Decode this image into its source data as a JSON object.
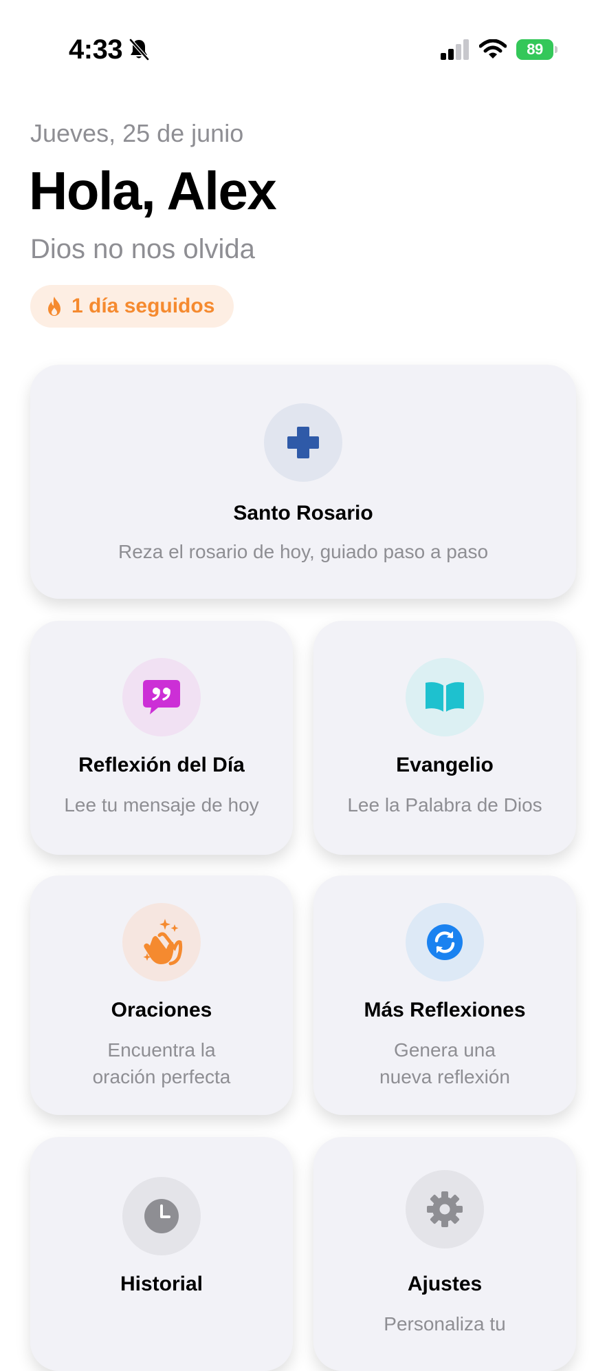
{
  "status_bar": {
    "time": "4:33",
    "battery": "89"
  },
  "header": {
    "date": "Jueves, 25 de junio",
    "greeting": "Hola, Alex",
    "subtitle": "Dios no nos olvida",
    "streak": "1 día seguidos"
  },
  "cards": {
    "rosario": {
      "title": "Santo Rosario",
      "desc": "Reza el rosario de hoy, guiado paso a paso",
      "icon": "plus-icon",
      "icon_color": "#2f5aa8",
      "bg_color": "#e1e5ef"
    },
    "reflexion": {
      "title": "Reflexión del Día",
      "desc": "Lee tu mensaje de hoy",
      "icon": "quote-bubble-icon",
      "icon_color": "#cc2fd6",
      "bg_color": "#f1e1f3"
    },
    "evangelio": {
      "title": "Evangelio",
      "desc": "Lee la Palabra de Dios",
      "icon": "open-book-icon",
      "icon_color": "#1ec1cf",
      "bg_color": "#dcf0f3"
    },
    "oraciones": {
      "title": "Oraciones",
      "desc_line1": "Encuentra la",
      "desc_line2": "oración perfecta",
      "icon": "clapping-hands-icon",
      "icon_color": "#f58a2f",
      "bg_color": "#f6e6e0"
    },
    "mas_reflexiones": {
      "title": "Más Reflexiones",
      "desc_line1": "Genera una",
      "desc_line2": "nueva reflexión",
      "icon": "refresh-icon",
      "icon_color": "#1a82f0",
      "bg_color": "#dde9f6"
    },
    "historial": {
      "title": "Historial",
      "icon": "clock-icon",
      "icon_color": "#8e8e93",
      "bg_color": "#e4e4e9"
    },
    "ajustes": {
      "title": "Ajustes",
      "desc": "Personaliza tu",
      "icon": "gear-icon",
      "icon_color": "#8e8e93",
      "bg_color": "#e4e4e9"
    }
  }
}
